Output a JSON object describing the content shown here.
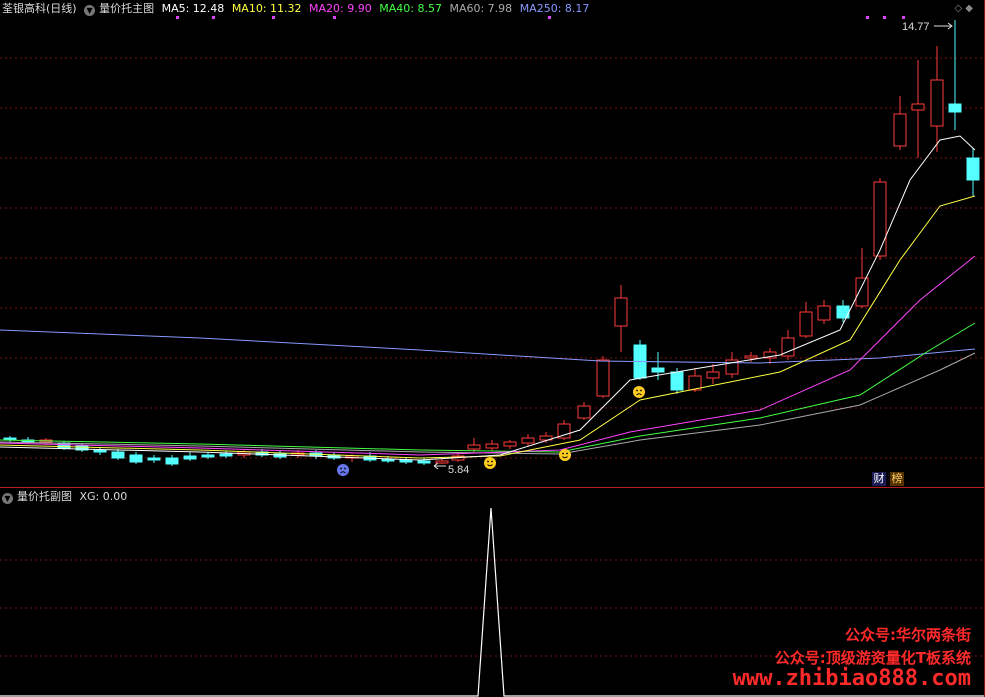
{
  "main": {
    "stock": "荃银高科(日线)",
    "indicator": "量价托主图",
    "ma": [
      {
        "label": "MA5: 12.48",
        "color": "#ffffff"
      },
      {
        "label": "MA10: 11.32",
        "color": "#ffff44"
      },
      {
        "label": "MA20: 9.90",
        "color": "#ff44ff"
      },
      {
        "label": "MA40: 8.57",
        "color": "#44ff44"
      },
      {
        "label": "MA60: 7.98",
        "color": "#aaaaaa"
      },
      {
        "label": "MA250: 8.17",
        "color": "#8899ff"
      }
    ],
    "high_label": "14.77",
    "low_label": "5.84",
    "badges": {
      "cai": "财",
      "bang": "榜"
    }
  },
  "sub": {
    "indicator": "量价托副图",
    "xg": "XG: 0.00"
  },
  "watermark": {
    "line1": "公众号:华尔两条街",
    "line2": "公众号:顶级游资量化T板系统",
    "url": "www.zhibiao888.com"
  },
  "colors": {
    "up": "#ff3a3a",
    "down": "#54ffff",
    "grid": "#7a1010",
    "bg": "#000000"
  }
}
